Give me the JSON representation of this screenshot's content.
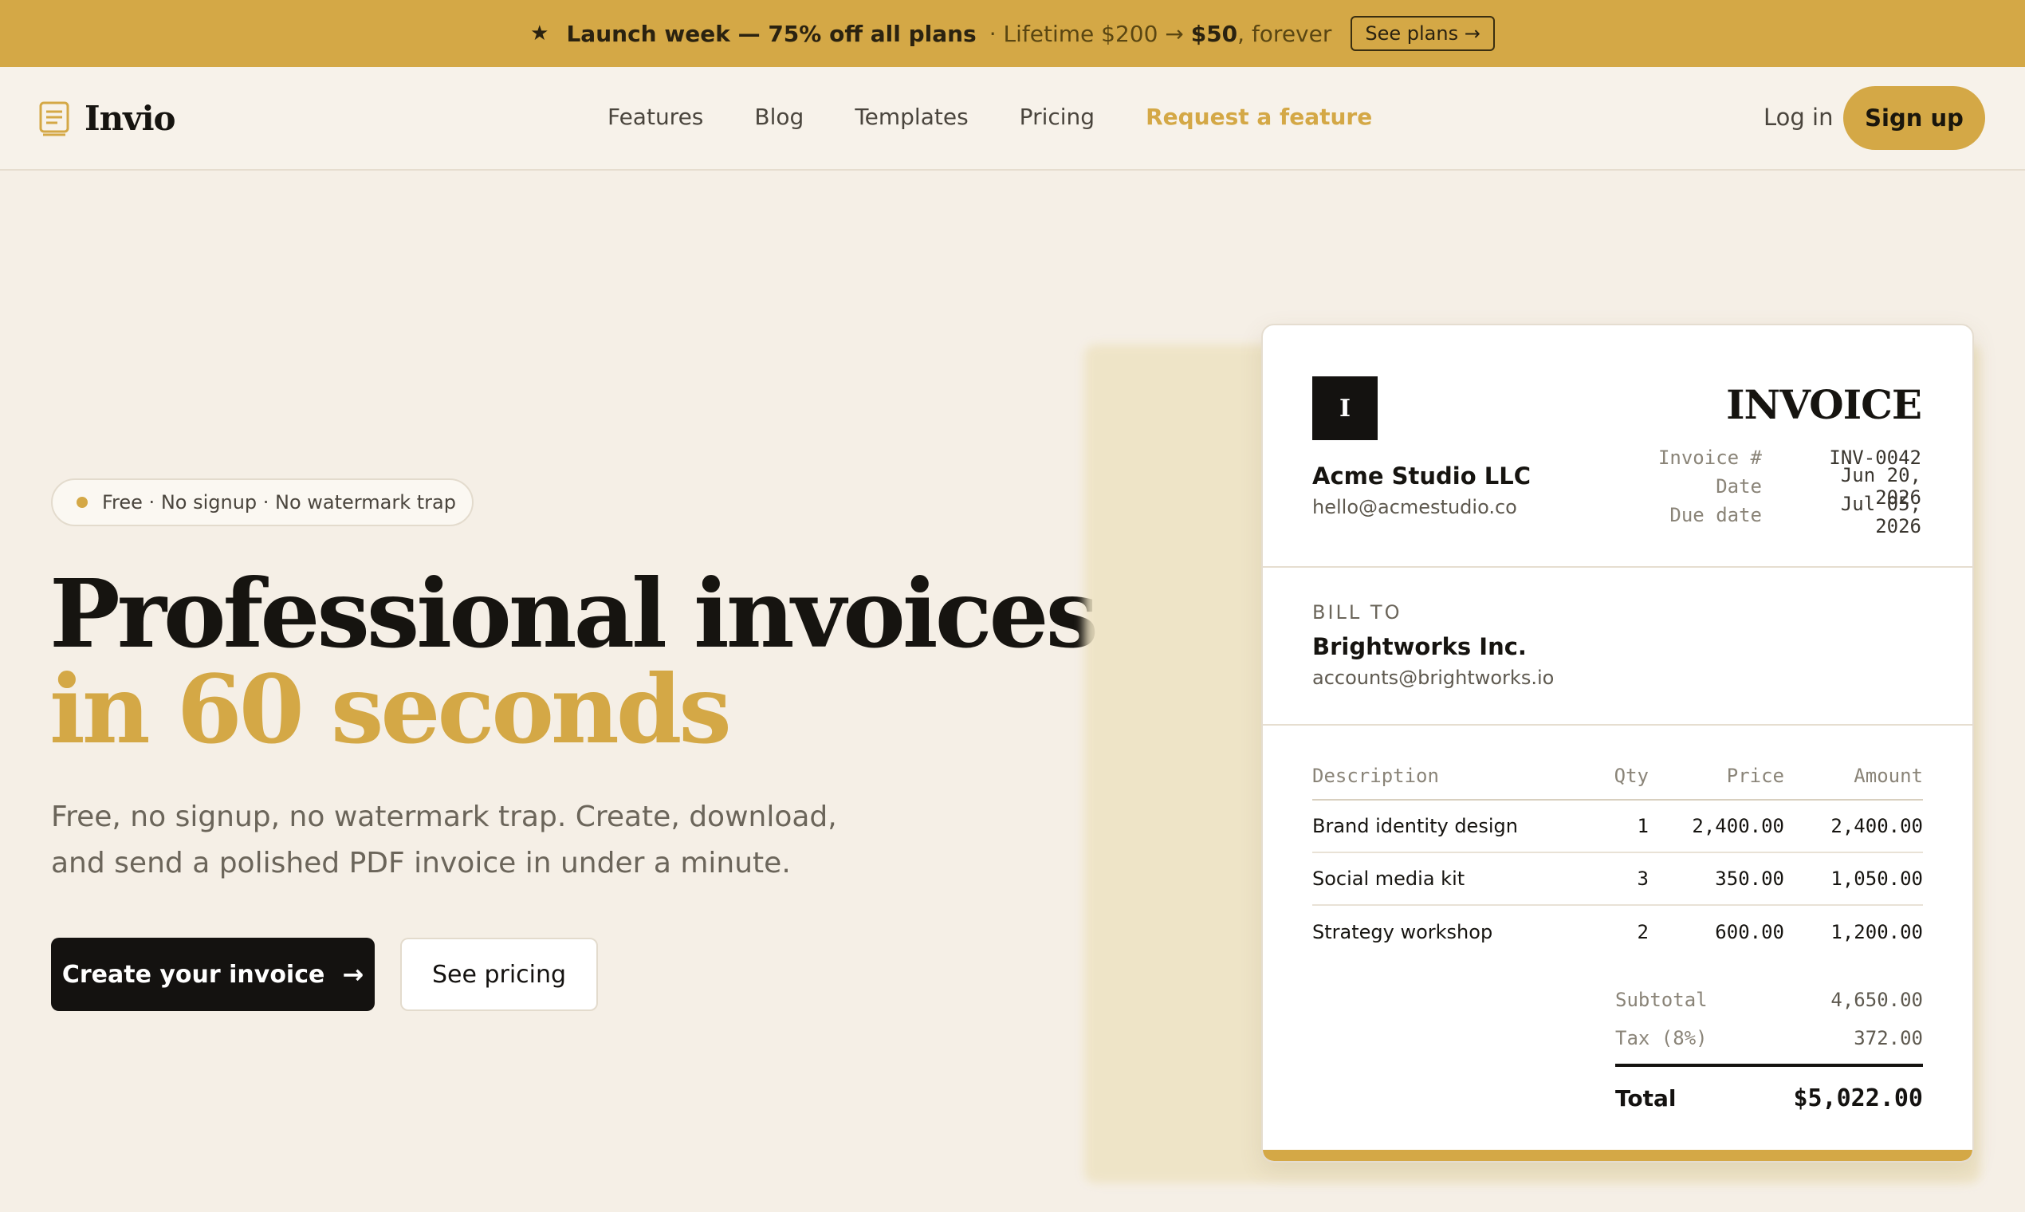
{
  "banner": {
    "icon": "star-icon",
    "headline": "Launch week — 75% off all plans",
    "lifetime_prefix": "· Lifetime $200 → ",
    "lifetime_price": "$50",
    "lifetime_suffix": ", forever",
    "cta": "See plans →",
    "bg_color": "#d4a846"
  },
  "nav": {
    "brand": "Invio",
    "links": [
      "Features",
      "Blog",
      "Templates",
      "Pricing"
    ],
    "highlight_link": "Request a feature",
    "login": "Log in",
    "signup": "Sign up"
  },
  "hero": {
    "pill": "Free · No signup · No watermark trap",
    "title_line1": "Professional invoices",
    "title_line2": "in 60 seconds",
    "subtitle": "Free, no signup, no watermark trap. Create, download, and send a polished PDF invoice in under a minute.",
    "cta_primary": "Create your invoice",
    "cta_secondary": "See pricing"
  },
  "invoice": {
    "logo_letter": "I",
    "title": "INVOICE",
    "from_name": "Acme Studio LLC",
    "from_email": "hello@acmestudio.co",
    "meta": [
      {
        "key": "Invoice #",
        "value": "INV-0042"
      },
      {
        "key": "Date",
        "value": "Jun 20, 2026"
      },
      {
        "key": "Due date",
        "value": "Jul 05, 2026"
      }
    ],
    "bill_to_label": "BILL TO",
    "bill_to_name": "Brightworks Inc.",
    "bill_to_email": "accounts@brightworks.io",
    "columns": [
      "Description",
      "Qty",
      "Price",
      "Amount"
    ],
    "items": [
      {
        "description": "Brand identity design",
        "qty": "1",
        "price": "2,400.00",
        "amount": "2,400.00"
      },
      {
        "description": "Social media kit",
        "qty": "3",
        "price": "350.00",
        "amount": "1,050.00"
      },
      {
        "description": "Strategy workshop",
        "qty": "2",
        "price": "600.00",
        "amount": "1,200.00"
      }
    ],
    "subtotal_label": "Subtotal",
    "subtotal": "4,650.00",
    "tax_label": "Tax (8%)",
    "tax": "372.00",
    "total_label": "Total",
    "total": "$5,022.00"
  },
  "colors": {
    "accent": "#d4a846",
    "dark": "#141210",
    "background": "#f5efe6"
  }
}
